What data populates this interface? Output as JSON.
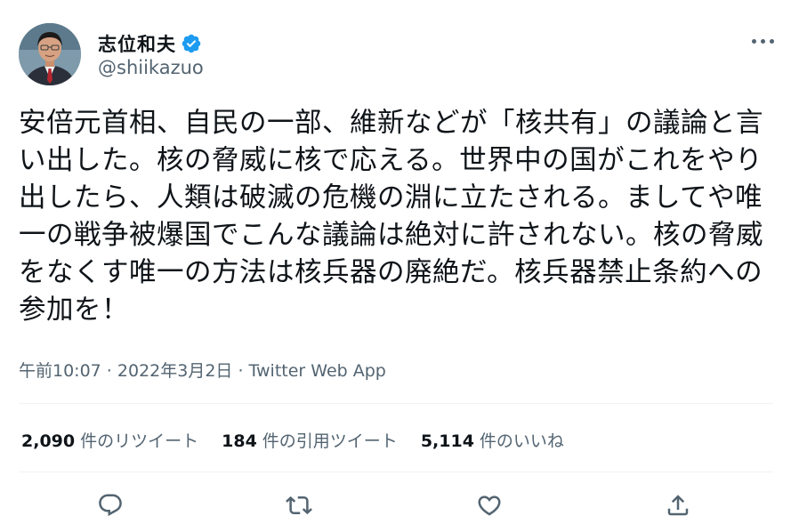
{
  "author": {
    "name": "志位和夫",
    "handle": "@shiikazuo",
    "verified": true
  },
  "tweet": {
    "text": "安倍元首相、自民の一部、維新などが「核共有」の議論と言い出した。核の脅威に核で応える。世界中の国がこれをやり出したら、人類は破滅の危機の淵に立たされる。ましてや唯一の戦争被爆国でこんな議論は絶対に許されない。核の脅威をなくす唯一の方法は核兵器の廃絶だ。核兵器禁止条約への参加を！",
    "time": "午前10:07",
    "date": "2022年3月2日",
    "separator": " · ",
    "source": "Twitter Web App"
  },
  "stats": {
    "retweets_count": "2,090",
    "retweets_label": "件のリツイート",
    "quotes_count": "184",
    "quotes_label": "件の引用ツイート",
    "likes_count": "5,114",
    "likes_label": "件のいいね"
  },
  "icons": {
    "verified": "verified-badge-icon",
    "more": "more-options-icon",
    "reply": "reply-icon",
    "retweet": "retweet-icon",
    "like": "like-icon",
    "share": "share-icon"
  },
  "colors": {
    "text": "#0f1419",
    "secondary": "#536471",
    "verified": "#1d9bf0",
    "divider": "#eff3f4"
  }
}
